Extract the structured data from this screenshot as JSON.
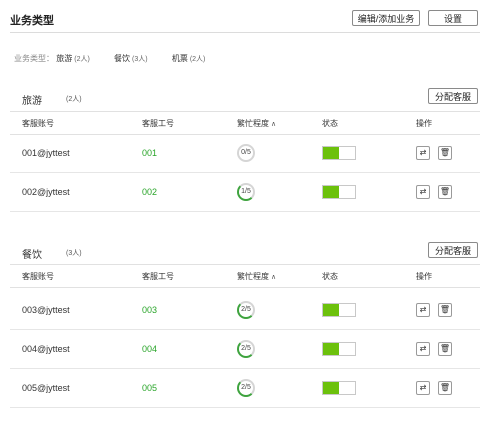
{
  "header": {
    "title": "业务类型",
    "edit_button": "编辑/添加业务",
    "settings_button": "设置"
  },
  "filter": {
    "label": "业务类型：",
    "items": [
      {
        "name": "旅游",
        "count": "(2人)"
      },
      {
        "name": "餐饮",
        "count": "(3人)"
      },
      {
        "name": "机票",
        "count": "(2人)"
      }
    ]
  },
  "columns": {
    "account": "客服账号",
    "code": "客服工号",
    "busy": "繁忙程度",
    "sort_icon": "∧",
    "status": "状态",
    "action": "操作"
  },
  "sections": [
    {
      "title": "旅游",
      "count": "(2人)",
      "assign_button": "分配客服",
      "rows": [
        {
          "account": "001@jyttest",
          "code": "001",
          "busy": "0/5",
          "busy_level": 0,
          "status_on": true
        },
        {
          "account": "002@jyttest",
          "code": "002",
          "busy": "1/5",
          "busy_level": 0.2,
          "status_on": true
        }
      ]
    },
    {
      "title": "餐饮",
      "count": "(3人)",
      "assign_button": "分配客服",
      "rows": [
        {
          "account": "003@jyttest",
          "code": "003",
          "busy": "2/5",
          "busy_level": 0.4,
          "status_on": true
        },
        {
          "account": "004@jyttest",
          "code": "004",
          "busy": "2/5",
          "busy_level": 0.4,
          "status_on": true
        },
        {
          "account": "005@jyttest",
          "code": "005",
          "busy": "2/5",
          "busy_level": 0.4,
          "status_on": true
        }
      ]
    }
  ],
  "icons": {
    "transfer": "transfer-icon",
    "delete": "trash-icon"
  },
  "colors": {
    "accent_green": "#6cc10c",
    "code_green": "#2aa52a",
    "gauge_green": "#3ea33e"
  }
}
